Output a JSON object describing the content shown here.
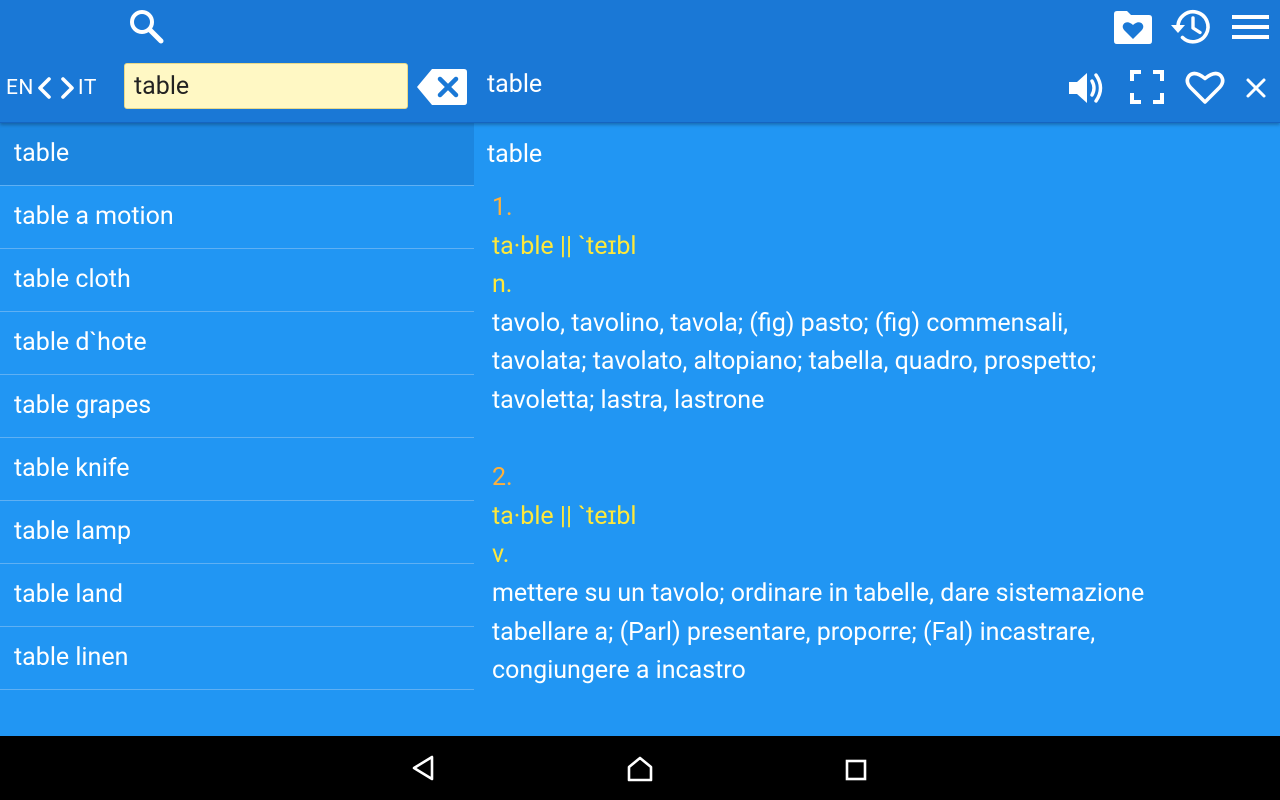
{
  "toolbar": {
    "icons": [
      "search-icon",
      "favorites-folder-icon",
      "history-icon",
      "menu-icon"
    ]
  },
  "lang_switch": {
    "from": "EN",
    "to": "IT"
  },
  "search": {
    "value": "table",
    "placeholder": ""
  },
  "entry_bar": {
    "title": "table",
    "icons": [
      "speaker-icon",
      "fullscreen-icon",
      "heart-icon",
      "close-icon"
    ]
  },
  "word_list": {
    "items": [
      {
        "label": "table",
        "selected": true
      },
      {
        "label": "table a motion"
      },
      {
        "label": "table cloth"
      },
      {
        "label": "table d`hote"
      },
      {
        "label": "table grapes"
      },
      {
        "label": "table knife"
      },
      {
        "label": "table lamp"
      },
      {
        "label": "table land"
      },
      {
        "label": "table linen"
      }
    ]
  },
  "definition": {
    "headword": "table",
    "senses": [
      {
        "number": "1.",
        "pronunciation": "ta·ble || `teɪbl",
        "pos": "n.",
        "translation_lines": [
          "tavolo, tavolino, tavola; (fig) pasto; (fig) commensali,",
          "tavolata; tavolato, altopiano; tabella, quadro, prospetto;",
          "tavoletta; lastra, lastrone"
        ]
      },
      {
        "number": "2.",
        "pronunciation": "ta·ble || `teɪbl",
        "pos": "v.",
        "translation_lines": [
          "mettere su un tavolo; ordinare in tabelle, dare sistemazione",
          "tabellare a; (Parl) presentare, proporre; (Fal) incastrare,",
          "congiungere a incastro"
        ]
      }
    ]
  },
  "colors": {
    "toolbar_bg": "#1a78d6",
    "content_bg": "#2196f3",
    "selected_row": "#1c86e0",
    "search_field_bg": "#fff8c4",
    "sense_number": "#ffb03b",
    "pronunciation": "#ffe83a"
  },
  "system_nav": {
    "icons": [
      "back-icon",
      "home-icon",
      "recents-icon"
    ]
  }
}
